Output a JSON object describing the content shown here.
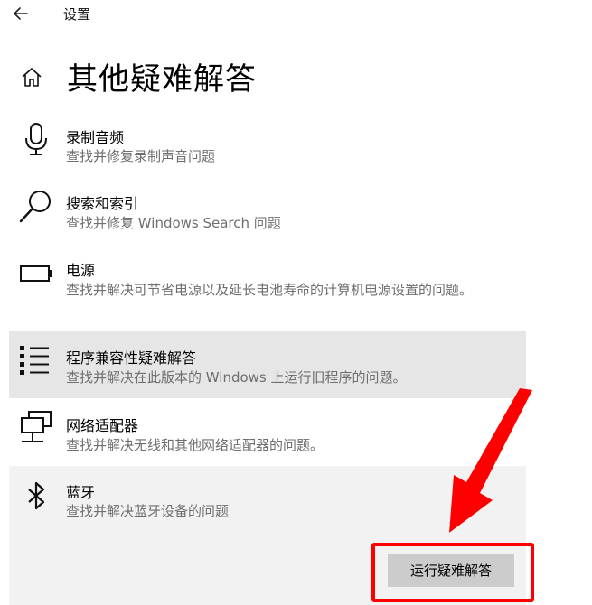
{
  "header": {
    "title": "设置"
  },
  "page": {
    "title": "其他疑难解答"
  },
  "items": [
    {
      "icon": "microphone-icon",
      "title": "录制音频",
      "desc": "查找并修复录制声音问题"
    },
    {
      "icon": "search-icon",
      "title": "搜索和索引",
      "desc": "查找并修复 Windows Search 问题"
    },
    {
      "icon": "battery-icon",
      "title": "电源",
      "desc": "查找并解决可节省电源以及延长电池寿命的计算机电源设置的问题。"
    },
    {
      "icon": "program-list-icon",
      "title": "程序兼容性疑难解答",
      "desc": "查找并解决在此版本的 Windows 上运行旧程序的问题。"
    },
    {
      "icon": "network-adapter-icon",
      "title": "网络适配器",
      "desc": "查找并解决无线和其他网络适配器的问题。"
    },
    {
      "icon": "bluetooth-icon",
      "title": "蓝牙",
      "desc": "查找并解决蓝牙设备的问题"
    }
  ],
  "actions": {
    "run_label": "运行疑难解答"
  },
  "colors": {
    "annotation": "#ff0000",
    "selected_bg": "#e6e6e6",
    "expanded_bg": "#f2f2f2",
    "button_bg": "#cccccc"
  }
}
